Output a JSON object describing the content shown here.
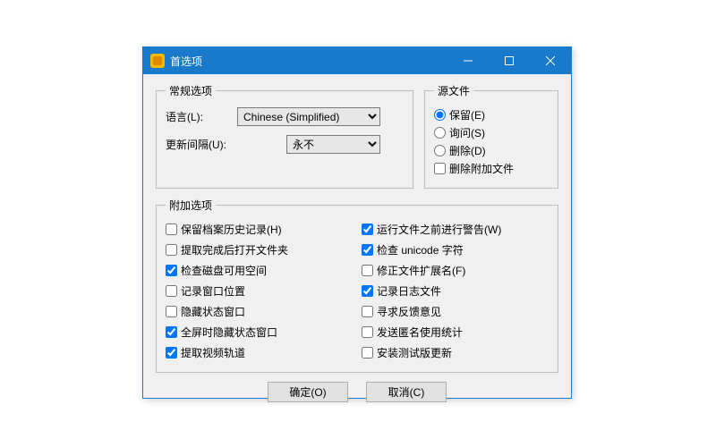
{
  "window": {
    "title": "首选项"
  },
  "general": {
    "legend": "常规选项",
    "language_label": "语言(L):",
    "language_value": "Chinese (Simplified)",
    "interval_label": "更新间隔(U):",
    "interval_value": "永不"
  },
  "source": {
    "legend": "源文件",
    "options": [
      {
        "label": "保留(E)",
        "checked": true
      },
      {
        "label": "询问(S)",
        "checked": false
      },
      {
        "label": "删除(D)",
        "checked": false
      }
    ],
    "delete_attached": {
      "label": "删除附加文件",
      "checked": false
    }
  },
  "additional": {
    "legend": "附加选项",
    "left": [
      {
        "label": "保留档案历史记录(H)",
        "checked": false
      },
      {
        "label": "提取完成后打开文件夹",
        "checked": false
      },
      {
        "label": "检查磁盘可用空间",
        "checked": true
      },
      {
        "label": "记录窗口位置",
        "checked": false
      },
      {
        "label": "隐藏状态窗口",
        "checked": false
      },
      {
        "label": "全屏时隐藏状态窗口",
        "checked": true
      },
      {
        "label": "提取视频轨道",
        "checked": true
      }
    ],
    "right": [
      {
        "label": "运行文件之前进行警告(W)",
        "checked": true
      },
      {
        "label": "检查 unicode 字符",
        "checked": true
      },
      {
        "label": "修正文件扩展名(F)",
        "checked": false
      },
      {
        "label": "记录日志文件",
        "checked": true
      },
      {
        "label": "寻求反馈意见",
        "checked": false
      },
      {
        "label": "发送匿名使用统计",
        "checked": false
      },
      {
        "label": "安装测试版更新",
        "checked": false
      }
    ]
  },
  "buttons": {
    "ok": "确定(O)",
    "cancel": "取消(C)"
  }
}
